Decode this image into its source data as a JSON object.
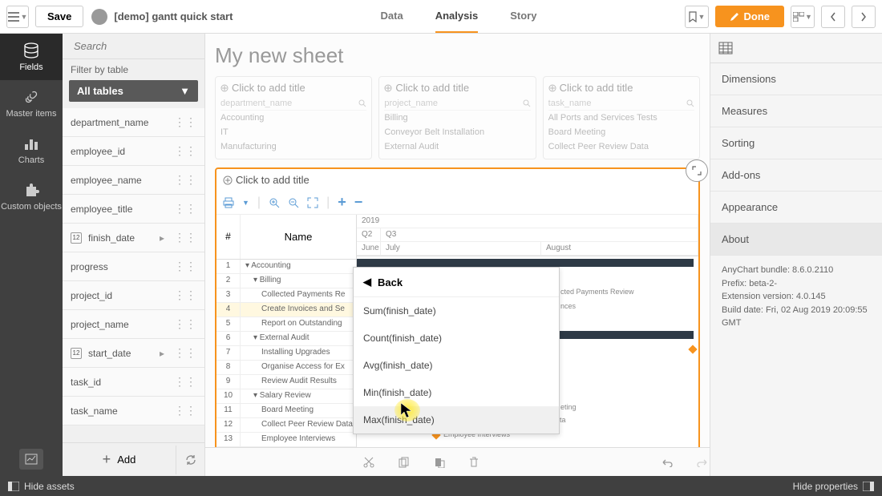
{
  "topbar": {
    "save_label": "Save",
    "app_title": "[demo] gantt quick start",
    "tabs": [
      "Data",
      "Analysis",
      "Story"
    ],
    "active_tab": 1,
    "done_label": "Done"
  },
  "left_sidebar": {
    "items": [
      "Fields",
      "Master items",
      "Charts",
      "Custom objects"
    ],
    "active": 0
  },
  "fields_panel": {
    "search_placeholder": "Search",
    "filter_label": "Filter by table",
    "tables_label": "All tables",
    "fields": [
      {
        "label": "department_name",
        "date": false
      },
      {
        "label": "employee_id",
        "date": false
      },
      {
        "label": "employee_name",
        "date": false
      },
      {
        "label": "employee_title",
        "date": false
      },
      {
        "label": "finish_date",
        "date": true,
        "expand": true
      },
      {
        "label": "progress",
        "date": false
      },
      {
        "label": "project_id",
        "date": false
      },
      {
        "label": "project_name",
        "date": false
      },
      {
        "label": "start_date",
        "date": true,
        "expand": true
      },
      {
        "label": "task_id",
        "date": false
      },
      {
        "label": "task_name",
        "date": false
      }
    ],
    "add_label": "Add"
  },
  "sheet": {
    "title": "My new sheet",
    "add_title_label": "Click to add title",
    "top_cards": [
      {
        "search": "department_name",
        "items": [
          "Accounting",
          "IT",
          "Manufacturing"
        ]
      },
      {
        "search": "project_name",
        "items": [
          "Billing",
          "Conveyor Belt Installation",
          "External Audit"
        ]
      },
      {
        "search": "task_name",
        "items": [
          "All Ports and Services Tests",
          "Board Meeting",
          "Collect Peer Review Data"
        ]
      }
    ]
  },
  "gantt": {
    "hash": "#",
    "name_label": "Name",
    "year": "2019",
    "quarters": [
      "Q2",
      "Q3"
    ],
    "months": [
      "June",
      "July",
      "August"
    ],
    "rows": [
      {
        "num": "1",
        "name": "Accounting"
      },
      {
        "num": "2",
        "name": "Billing"
      },
      {
        "num": "3",
        "name": "Collected Payments Re"
      },
      {
        "num": "4",
        "name": "Create Invoices and Se"
      },
      {
        "num": "5",
        "name": "Report on Outstanding"
      },
      {
        "num": "6",
        "name": "External Audit"
      },
      {
        "num": "7",
        "name": "Installing Upgrades"
      },
      {
        "num": "8",
        "name": "Organise Access for Ex"
      },
      {
        "num": "9",
        "name": "Review Audit Results"
      },
      {
        "num": "10",
        "name": "Salary Review"
      },
      {
        "num": "11",
        "name": "Board Meeting"
      },
      {
        "num": "12",
        "name": "Collect Peer Review Data"
      },
      {
        "num": "13",
        "name": "Employee Interviews"
      }
    ],
    "bar_labels": {
      "collected_payments": "cted Payments Review",
      "invoices": "nces",
      "meeting": "eting",
      "collect_peer": "Collect Peer Review Data",
      "interviews": "Employee Interviews"
    }
  },
  "agg_menu": {
    "back_label": "Back",
    "items": [
      "Sum(finish_date)",
      "Count(finish_date)",
      "Avg(finish_date)",
      "Min(finish_date)",
      "Max(finish_date)"
    ]
  },
  "right_panel": {
    "sections": [
      "Dimensions",
      "Measures",
      "Sorting",
      "Add-ons",
      "Appearance",
      "About"
    ],
    "active": 5,
    "about": {
      "line1": "AnyChart bundle: 8.6.0.2110",
      "line2": "Prefix: beta-2-",
      "line3": "Extension version: 4.0.145",
      "line4": "Build date: Fri, 02 Aug 2019 20:09:55 GMT"
    }
  },
  "bottom_bar": {
    "hide_assets": "Hide assets",
    "hide_properties": "Hide properties"
  }
}
